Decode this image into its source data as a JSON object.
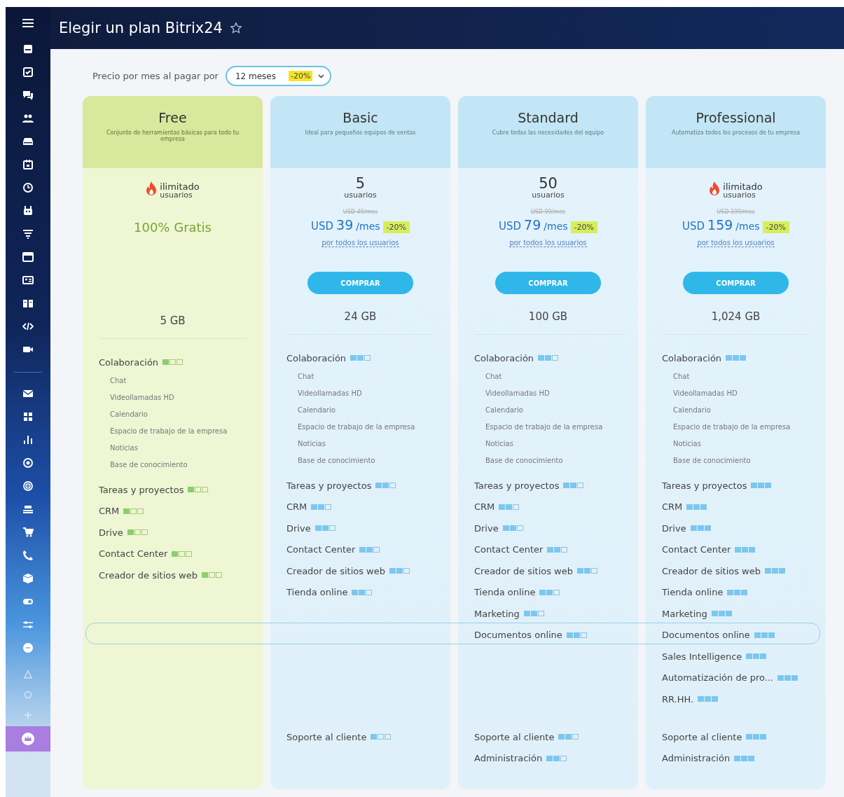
{
  "header": {
    "title": "Elegir un plan Bitrix24"
  },
  "period": {
    "label": "Precio por mes al pagar por",
    "value": "12 meses",
    "discount": "-20%"
  },
  "plans": [
    {
      "name": "Free",
      "kind": "free",
      "description": "Conjunto de herramientas básicas para todo tu empresa",
      "unlimited": true,
      "users": "ilimitado",
      "users_label": "usuarios",
      "free_text": "100% Gratis",
      "storage": "5 GB",
      "features": [
        {
          "name": "Colaboración",
          "stars": 1,
          "children": [
            {
              "name": "Chat"
            },
            {
              "name": "Videollamadas HD"
            },
            {
              "name": "Calendario"
            },
            {
              "name": "Espacio de trabajo de la empresa"
            },
            {
              "name": "Noticias"
            },
            {
              "name": "Base de conocimiento"
            }
          ]
        },
        {
          "name": "Tareas y proyectos",
          "stars": 1
        },
        {
          "name": "CRM",
          "stars": 1
        },
        {
          "name": "Drive",
          "stars": 1
        },
        {
          "name": "Contact Center",
          "stars": 1
        },
        {
          "name": "Creador de sitios web",
          "stars": 1
        }
      ]
    },
    {
      "name": "Basic",
      "kind": "paid",
      "description": "Ideal para pequeños equipos de ventas",
      "unlimited": false,
      "users": "5",
      "users_label": "usuarios",
      "price": {
        "old": "USD 49/mes",
        "currency": "USD",
        "amount": "39",
        "unit": "/mes",
        "discount": "-20%",
        "note": "por todos los usuarios"
      },
      "buy": "COMPRAR",
      "storage": "24 GB",
      "features": [
        {
          "name": "Colaboración",
          "stars": 2,
          "children": [
            {
              "name": "Chat"
            },
            {
              "name": "Videollamadas HD"
            },
            {
              "name": "Calendario"
            },
            {
              "name": "Espacio de trabajo de la empresa"
            },
            {
              "name": "Noticias"
            },
            {
              "name": "Base de conocimiento"
            }
          ]
        },
        {
          "name": "Tareas y proyectos",
          "stars": 2
        },
        {
          "name": "CRM",
          "stars": 2
        },
        {
          "name": "Drive",
          "stars": 2
        },
        {
          "name": "Contact Center",
          "stars": 2
        },
        {
          "name": "Creador de sitios web",
          "stars": 2
        },
        {
          "name": "Tienda online",
          "stars": 2
        }
      ],
      "support": [
        {
          "name": "Soporte al cliente",
          "stars": 1
        }
      ]
    },
    {
      "name": "Standard",
      "kind": "paid",
      "description": "Cubre todas las necesidades del equipo",
      "unlimited": false,
      "users": "50",
      "users_label": "usuarios",
      "price": {
        "old": "USD 99/mes",
        "currency": "USD",
        "amount": "79",
        "unit": "/mes",
        "discount": "-20%",
        "note": "por todos los usuarios"
      },
      "buy": "COMPRAR",
      "storage": "100 GB",
      "features": [
        {
          "name": "Colaboración",
          "stars": 2,
          "children": [
            {
              "name": "Chat"
            },
            {
              "name": "Videollamadas HD"
            },
            {
              "name": "Calendario"
            },
            {
              "name": "Espacio de trabajo de la empresa"
            },
            {
              "name": "Noticias"
            },
            {
              "name": "Base de conocimiento"
            }
          ]
        },
        {
          "name": "Tareas y proyectos",
          "stars": 2
        },
        {
          "name": "CRM",
          "stars": 2
        },
        {
          "name": "Drive",
          "stars": 2
        },
        {
          "name": "Contact Center",
          "stars": 2
        },
        {
          "name": "Creador de sitios web",
          "stars": 2
        },
        {
          "name": "Tienda online",
          "stars": 2
        },
        {
          "name": "Marketing",
          "stars": 2
        },
        {
          "name": "Documentos online",
          "stars": 2
        }
      ],
      "support": [
        {
          "name": "Soporte al cliente",
          "stars": 2
        },
        {
          "name": "Administración",
          "stars": 2
        }
      ]
    },
    {
      "name": "Professional",
      "kind": "paid",
      "description": "Automatiza todos los procesos de tu empresa",
      "unlimited": true,
      "users": "ilimitado",
      "users_label": "usuarios",
      "price": {
        "old": "USD 199/mes",
        "currency": "USD",
        "amount": "159",
        "unit": "/mes",
        "discount": "-20%",
        "note": "por todos los usuarios"
      },
      "buy": "COMPRAR",
      "storage": "1,024 GB",
      "features": [
        {
          "name": "Colaboración",
          "stars": 3,
          "children": [
            {
              "name": "Chat"
            },
            {
              "name": "Videollamadas HD"
            },
            {
              "name": "Calendario"
            },
            {
              "name": "Espacio de trabajo de la empresa"
            },
            {
              "name": "Noticias"
            },
            {
              "name": "Base de conocimiento"
            }
          ]
        },
        {
          "name": "Tareas y proyectos",
          "stars": 3
        },
        {
          "name": "CRM",
          "stars": 3
        },
        {
          "name": "Drive",
          "stars": 3
        },
        {
          "name": "Contact Center",
          "stars": 3
        },
        {
          "name": "Creador de sitios web",
          "stars": 3
        },
        {
          "name": "Tienda online",
          "stars": 3
        },
        {
          "name": "Marketing",
          "stars": 3
        },
        {
          "name": "Documentos online",
          "stars": 3
        },
        {
          "name": "Sales Intelligence",
          "stars": 3
        },
        {
          "name": "Automatización de pro...",
          "stars": 3
        },
        {
          "name": "RR.HH.",
          "stars": 3
        }
      ],
      "support": [
        {
          "name": "Soporte al cliente",
          "stars": 3
        },
        {
          "name": "Administración",
          "stars": 3
        }
      ]
    }
  ]
}
